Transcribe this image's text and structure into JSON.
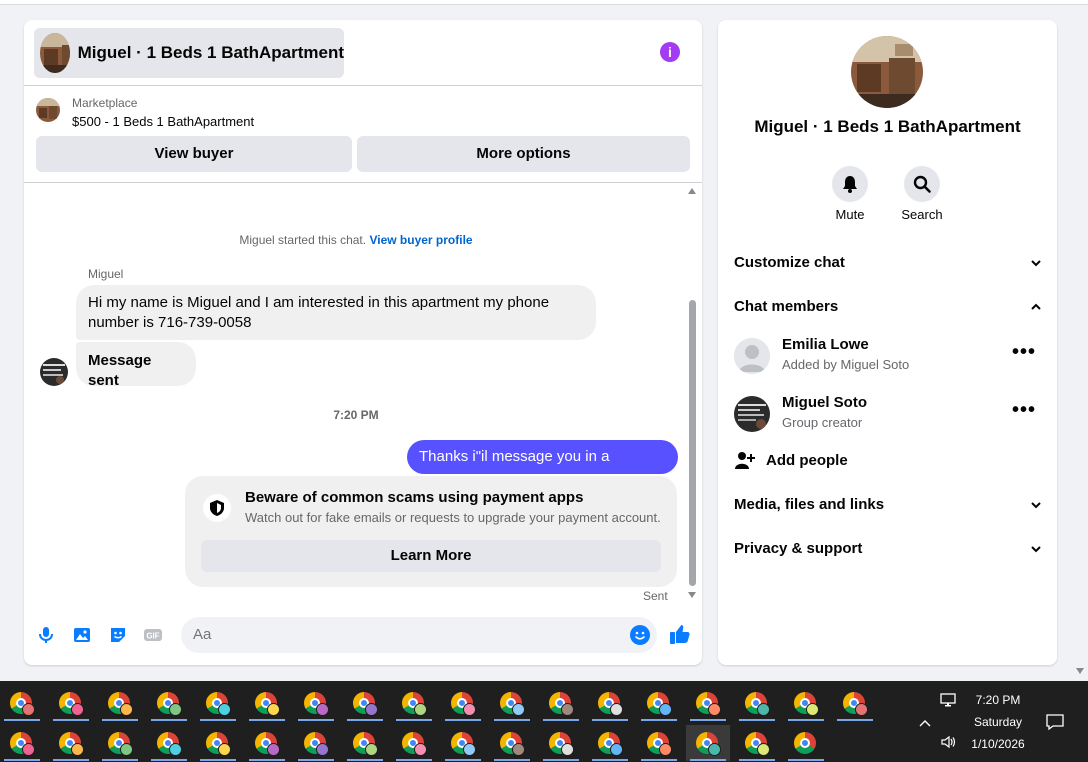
{
  "header": {
    "title": "Miguel · 1 Beds 1 BathApartment",
    "info_icon": "i"
  },
  "marketplace": {
    "label": "Marketplace",
    "listing": "$500 - 1 Beds 1 BathApartment"
  },
  "actions": {
    "view_buyer": "View buyer",
    "more_options": "More options"
  },
  "conversation": {
    "started_text": "Miguel started this chat.",
    "started_link": "View buyer profile",
    "sender_name": "Miguel",
    "messages_in": [
      "Hi my name is Miguel and I am interested in this apartment my phone number is 716-739-0058",
      "Message sent"
    ],
    "timestamp": "7:20 PM",
    "message_out": "Thanks i\"il message you in a moment",
    "scam_card": {
      "title": "Beware of common scams using payment apps",
      "subtitle": "Watch out for fake emails or requests to upgrade your payment account.",
      "button": "Learn More"
    },
    "status": "Sent"
  },
  "composer": {
    "placeholder": "Aa",
    "icons": [
      "microphone-icon",
      "photo-icon",
      "sticker-icon",
      "gif-icon",
      "emoji-icon",
      "like-icon"
    ],
    "gif_label": "GIF"
  },
  "sidebar": {
    "title": "Miguel · 1 Beds 1 BathApartment",
    "mute_label": "Mute",
    "search_label": "Search",
    "sections": {
      "customize": "Customize chat",
      "members": "Chat members",
      "media": "Media, files and links",
      "privacy": "Privacy & support"
    },
    "members": [
      {
        "name": "Emilia Lowe",
        "sub": "Added by Miguel Soto"
      },
      {
        "name": "Miguel Soto",
        "sub": "Group creator"
      }
    ],
    "more_label": "•••",
    "add_people": "Add people"
  },
  "taskbar": {
    "time": "7:20 PM",
    "day": "Saturday",
    "date": "1/10/2026"
  },
  "colors": {
    "accent_blue": "#0a7cff",
    "outgoing_bubble": "#5851ff",
    "info_purple": "#a33bf2",
    "link": "#0064d1"
  }
}
